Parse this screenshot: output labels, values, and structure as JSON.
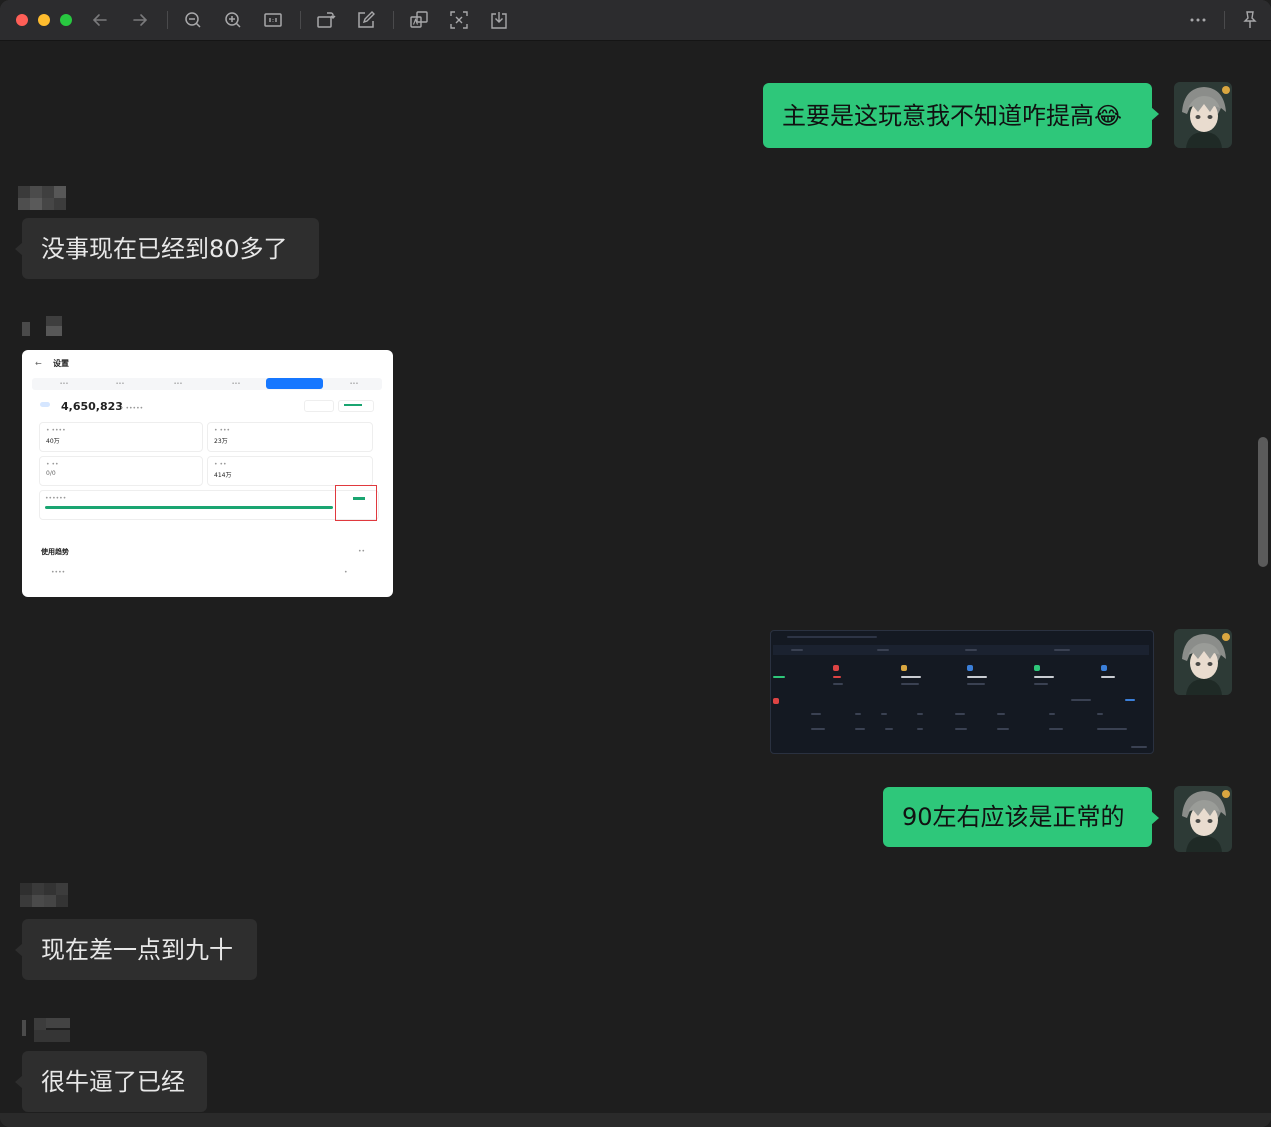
{
  "toolbar": {
    "icons": [
      "back-arrow-icon",
      "forward-arrow-icon",
      "zoom-out-icon",
      "zoom-in-icon",
      "actual-size-icon",
      "rotate-icon",
      "edit-icon",
      "translate-icon",
      "text-recognition-icon",
      "download-icon",
      "more-icon",
      "pin-icon"
    ]
  },
  "messages": [
    {
      "side": "me",
      "type": "text",
      "text": "主要是这玩意我不知道咋提高😂"
    },
    {
      "side": "other",
      "type": "text",
      "text": "没事现在已经到80多了"
    },
    {
      "side": "other",
      "type": "image",
      "description_id": "settings-screenshot"
    },
    {
      "side": "me",
      "type": "image",
      "description_id": "dashboard-screenshot"
    },
    {
      "side": "me",
      "type": "text",
      "text": "90左右应该是正常的"
    },
    {
      "side": "other",
      "type": "text",
      "text": "现在差一点到九十"
    },
    {
      "side": "other",
      "type": "text",
      "text": "很牛逼了已经"
    }
  ],
  "embedded_settings": {
    "title": "设置",
    "big_number": "4,650,823",
    "card1_value": "40万",
    "card2_value": "23万",
    "card3_value": "0/0",
    "card4_value": "414万",
    "section_title": "使用趋势",
    "accent": "#1677ff",
    "progress_color": "#1aa571",
    "highlight_color": "#e0393e"
  },
  "colors": {
    "background": "#1e1e1e",
    "bubble_me": "#2ec77a",
    "bubble_other": "#2e2e2e"
  }
}
